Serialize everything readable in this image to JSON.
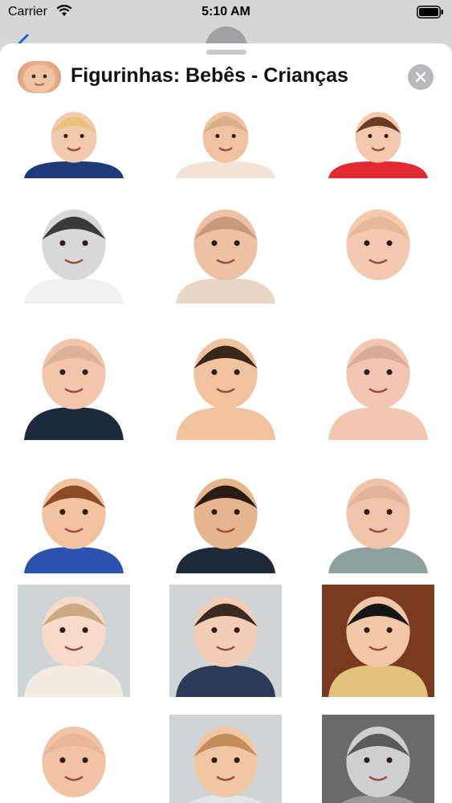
{
  "status_bar": {
    "carrier": "Carrier",
    "time": "5:10 AM"
  },
  "sheet": {
    "title": "Figurinhas: Bebês - Crianças",
    "close_icon": "close-x-icon"
  },
  "stickers": [
    {
      "name": "sticker-baby-flexing",
      "skin": "#f2c9ad",
      "hair": "#e8c27a",
      "shirt": "#1f3a7a"
    },
    {
      "name": "sticker-baby-smiling",
      "skin": "#f0c2a2",
      "hair": "#d7b08a",
      "shirt": "#f5e2d6"
    },
    {
      "name": "sticker-baby-cat-face",
      "skin": "#f4c8ad",
      "hair": "#6a3b22",
      "shirt": "#e22a34"
    },
    {
      "name": "sticker-baby-grumpy-bw",
      "skin": "#d8d8d8",
      "hair": "#3a3a3a",
      "shirt": "#f0f0f0"
    },
    {
      "name": "sticker-baby-frown",
      "skin": "#eec0a4",
      "hair": "#c99a7a",
      "shirt": "#e9d6c6"
    },
    {
      "name": "sticker-baby-mustache",
      "skin": "#f5c9b0",
      "hair": "#e4b899",
      "shirt": "#ffffff"
    },
    {
      "name": "sticker-baby-skeptical",
      "skin": "#f3c5aa",
      "hair": "#d8b39a",
      "shirt": "#1b2a3d"
    },
    {
      "name": "sticker-baby-stare",
      "skin": "#f0c39e",
      "hair": "#3a2618",
      "shirt": "#f0c39e"
    },
    {
      "name": "sticker-baby-laughing",
      "skin": "#f2c6b0",
      "hair": "#d9aa96",
      "shirt": "#f2c6b0"
    },
    {
      "name": "sticker-kid-thermometer",
      "skin": "#f2c3a0",
      "hair": "#8a4a24",
      "shirt": "#2a53b0"
    },
    {
      "name": "sticker-kid-messy-face",
      "skin": "#e6b58e",
      "hair": "#2a1b14",
      "shirt": "#1e2a3a"
    },
    {
      "name": "sticker-baby-sleeping",
      "skin": "#f1c3ab",
      "hair": "#e1b39c",
      "shirt": "#8fa0a0"
    },
    {
      "name": "sticker-girl-finger-mouth",
      "skin": "#f6dcc8",
      "hair": "#c9a883",
      "shirt": "#f2ece2"
    },
    {
      "name": "sticker-baby-overalls",
      "skin": "#f3cdb5",
      "hair": "#3b2a22",
      "shirt": "#2c3a58"
    },
    {
      "name": "sticker-cartoon-girl",
      "skin": "#f3c7a8",
      "hair": "#161616",
      "shirt": "#e2c27c"
    },
    {
      "name": "sticker-baby-big-smile",
      "skin": "#f1c2a6",
      "hair": "#e8b79a",
      "shirt": "#ffffff"
    },
    {
      "name": "sticker-baby-happy",
      "skin": "#f1c6a3",
      "hair": "#c48c5a",
      "shirt": "#dfe6ea"
    },
    {
      "name": "sticker-baby-vintage-bw",
      "skin": "#cfcfcf",
      "hair": "#5a5a5a",
      "shirt": "#9a9a9a"
    }
  ]
}
